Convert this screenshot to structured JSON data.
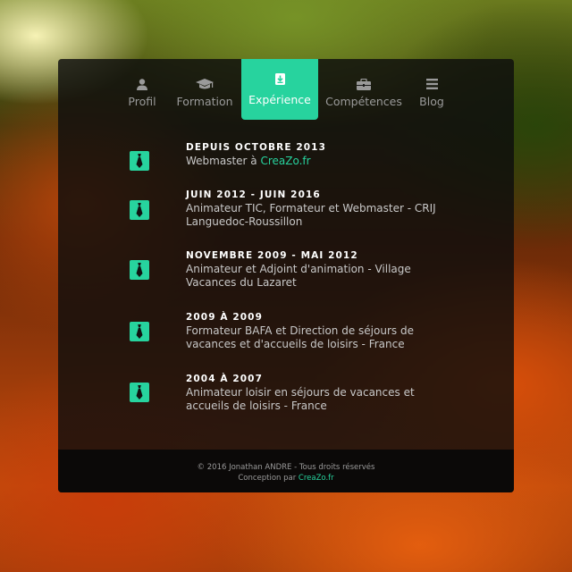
{
  "nav": {
    "items": [
      {
        "label": "Profil",
        "icon": "user-icon"
      },
      {
        "label": "Formation",
        "icon": "graduation-cap-icon"
      },
      {
        "label": "Expérience",
        "icon": "download-icon",
        "active": true
      },
      {
        "label": "Compétences",
        "icon": "briefcase-icon"
      },
      {
        "label": "Blog",
        "icon": "menu-icon"
      }
    ]
  },
  "experience": {
    "entries": [
      {
        "period": "DEPUIS OCTOBRE 2013",
        "description": "Webmaster à ",
        "link": "CreaZo.fr",
        "icon": "tie-icon"
      },
      {
        "period": "JUIN 2012 - JUIN 2016",
        "description": "Animateur TIC, Formateur et Webmaster - CRIJ Languedoc-Roussillon",
        "icon": "tie-icon"
      },
      {
        "period": "NOVEMBRE 2009 - MAI 2012",
        "description": "Animateur et Adjoint d'animation - Village Vacances du Lazaret",
        "icon": "tie-icon"
      },
      {
        "period": "2009 À 2009",
        "description": "Formateur BAFA et Direction de séjours de vacances et d'accueils de loisirs - France",
        "icon": "tie-icon"
      },
      {
        "period": "2004 À 2007",
        "description": "Animateur loisir en séjours de vacances et accueils de loisirs - France",
        "icon": "tie-icon"
      }
    ]
  },
  "footer": {
    "copyright": "© 2016 Jonathan ANDRE - Tous droits réservés",
    "design_prefix": "Conception par ",
    "design_link": "CreaZo.fr"
  },
  "colors": {
    "accent": "#27d39e",
    "panel": "#0e0e0e"
  }
}
